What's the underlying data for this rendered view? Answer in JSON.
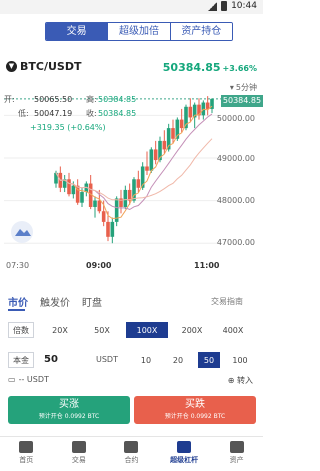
{
  "status": {
    "time": "10:44"
  },
  "tabs": [
    {
      "label": "交易",
      "active": true
    },
    {
      "label": "超级加倍",
      "active": false
    },
    {
      "label": "资产持仓",
      "active": false
    }
  ],
  "market": {
    "pair": "BTC/USDT",
    "price": "50384.85",
    "change": "+3.66%"
  },
  "ohlc": {
    "open_label": "开:",
    "open": "50065.50",
    "high_label": "高:",
    "high": "50384.85",
    "low_label": "低:",
    "low": "50047.19",
    "close_label": "收:",
    "close": "50384.85",
    "diff": "+319.35 (+0.64%)"
  },
  "chart": {
    "interval": "5分钟",
    "last_price": "50384.85",
    "y_ticks": [
      "50000.00",
      "49000.00",
      "48000.00",
      "47000.00"
    ],
    "x_ticks": [
      "07:30",
      "09:00",
      "11:00"
    ]
  },
  "chart_data": {
    "type": "candlestick",
    "y_ticks": [
      50000,
      49000,
      48000,
      47000
    ],
    "x_ticks": [
      "07:30",
      "09:00",
      "11:00"
    ],
    "candles": [
      [
        48400,
        48700,
        48300,
        48650
      ],
      [
        48650,
        48800,
        48200,
        48300
      ],
      [
        48300,
        48600,
        48200,
        48500
      ],
      [
        48500,
        48650,
        48100,
        48150
      ],
      [
        48150,
        48450,
        48050,
        48350
      ],
      [
        48350,
        48500,
        47900,
        47950
      ],
      [
        47950,
        48300,
        47850,
        48200
      ],
      [
        48200,
        48450,
        48100,
        48400
      ],
      [
        48400,
        48600,
        47800,
        47850
      ],
      [
        47850,
        48100,
        47600,
        48000
      ],
      [
        48000,
        48250,
        47700,
        47750
      ],
      [
        47750,
        48000,
        47400,
        47500
      ],
      [
        47500,
        47750,
        47050,
        47150
      ],
      [
        47150,
        47600,
        47000,
        47500
      ],
      [
        47500,
        48100,
        47400,
        48050
      ],
      [
        48050,
        48250,
        47700,
        47850
      ],
      [
        47850,
        48350,
        47800,
        48250
      ],
      [
        48250,
        48400,
        47900,
        48000
      ],
      [
        48000,
        48550,
        47950,
        48500
      ],
      [
        48500,
        48700,
        48200,
        48300
      ],
      [
        48300,
        48900,
        48250,
        48800
      ],
      [
        48800,
        49150,
        48600,
        48700
      ],
      [
        48700,
        49250,
        48650,
        49200
      ],
      [
        49200,
        49400,
        48850,
        48950
      ],
      [
        48950,
        49500,
        48900,
        49400
      ],
      [
        49400,
        49650,
        49100,
        49200
      ],
      [
        49200,
        49800,
        49150,
        49700
      ],
      [
        49700,
        49900,
        49350,
        49450
      ],
      [
        49450,
        49950,
        49400,
        49900
      ],
      [
        49900,
        50150,
        49600,
        49700
      ],
      [
        49700,
        50250,
        49650,
        50200
      ],
      [
        50200,
        50400,
        49850,
        49950
      ],
      [
        49950,
        50300,
        49700,
        50250
      ],
      [
        50250,
        50400,
        49900,
        50000
      ],
      [
        50000,
        50350,
        49900,
        50300
      ],
      [
        50300,
        50450,
        50000,
        50150
      ],
      [
        50150,
        50400,
        50050,
        50385
      ]
    ]
  },
  "order": {
    "tabs": [
      {
        "label": "市价",
        "active": true
      },
      {
        "label": "触发价",
        "active": false
      },
      {
        "label": "盯盘",
        "active": false
      }
    ],
    "guide": "交易指南",
    "leverage_label": "倍数",
    "leverage": [
      {
        "label": "20X",
        "active": false
      },
      {
        "label": "50X",
        "active": false
      },
      {
        "label": "100X",
        "active": true
      },
      {
        "label": "200X",
        "active": false
      },
      {
        "label": "400X",
        "active": false
      }
    ],
    "amount_label": "本金",
    "amount": "50",
    "unit": "USDT",
    "presets": [
      {
        "label": "10",
        "active": false
      },
      {
        "label": "20",
        "active": false
      },
      {
        "label": "50",
        "active": true
      },
      {
        "label": "100",
        "active": false
      }
    ],
    "available": "-- USDT",
    "transfer": "转入",
    "buy": {
      "label": "买涨",
      "sub": "预计开仓 0.0992 BTC"
    },
    "sell": {
      "label": "买跌",
      "sub": "预计开仓 0.0992 BTC"
    }
  },
  "nav": [
    {
      "label": "首页",
      "active": false
    },
    {
      "label": "交易",
      "active": false
    },
    {
      "label": "合约",
      "active": false
    },
    {
      "label": "超级杠杆",
      "active": true
    },
    {
      "label": "资产",
      "active": false
    }
  ],
  "colors": {
    "up": "#25a27b",
    "down": "#e8604c",
    "accent": "#1e3c90",
    "ma1": "#f1a45a",
    "ma2": "#c48fb7",
    "ma3": "#f0b8a9"
  }
}
